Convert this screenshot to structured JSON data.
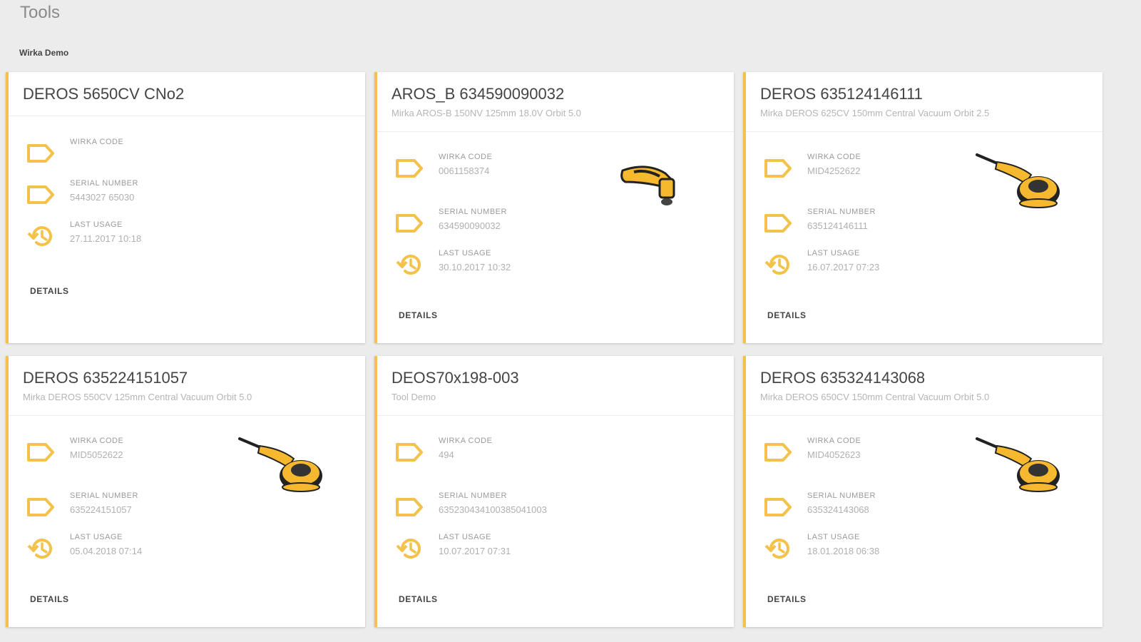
{
  "page": {
    "title": "Tools",
    "group": "Wirka Demo"
  },
  "colors": {
    "accent": "#f3c24a",
    "background": "#ececec",
    "card": "#ffffff"
  },
  "field_labels": {
    "code": "WIRKA CODE",
    "serial": "SERIAL NUMBER",
    "usage": "LAST USAGE"
  },
  "details_label": "DETAILS",
  "cards": [
    {
      "title": "DEROS 5650CV CNo2",
      "subtitle": "",
      "code": "",
      "serial": "5443027 65030",
      "usage": "27.11.2017 10:18",
      "image": "none"
    },
    {
      "title": "AROS_B 634590090032",
      "subtitle": "Mirka AROS-B 150NV 125mm 18.0V Orbit 5.0",
      "code": "0061158374",
      "serial": "634590090032",
      "usage": "30.10.2017 10:32",
      "image": "mini-sander-icon"
    },
    {
      "title": "DEROS 635124146111",
      "subtitle": "Mirka DEROS 625CV 150mm Central Vacuum Orbit 2.5",
      "code": "MID4252622",
      "serial": "635124146111",
      "usage": "16.07.2017 07:23",
      "image": "orbital-sander-icon"
    },
    {
      "title": "DEROS 635224151057",
      "subtitle": "Mirka DEROS 550CV 125mm Central Vacuum Orbit 5.0",
      "code": "MID5052622",
      "serial": "635224151057",
      "usage": "05.04.2018 07:14",
      "image": "orbital-sander-icon"
    },
    {
      "title": "DEOS70x198-003",
      "subtitle": "Tool Demo",
      "code": "494",
      "serial": "635230434100385041003",
      "usage": "10.07.2017 07:31",
      "image": "none"
    },
    {
      "title": "DEROS 635324143068",
      "subtitle": "Mirka DEROS 650CV 150mm Central Vacuum Orbit 5.0",
      "code": "MID4052623",
      "serial": "635324143068",
      "usage": "18.01.2018 06:38",
      "image": "orbital-sander-icon"
    }
  ]
}
